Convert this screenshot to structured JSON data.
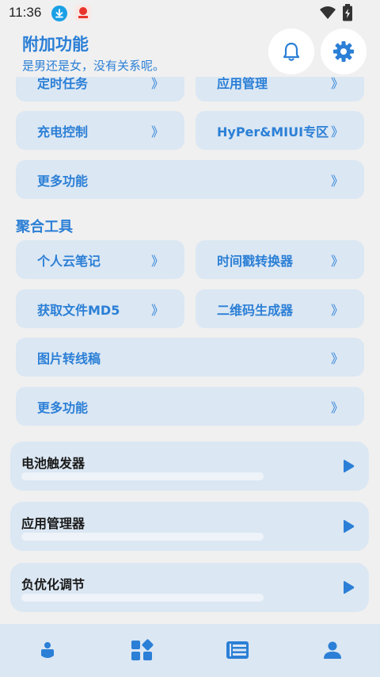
{
  "status": {
    "time": "11:36"
  },
  "header": {
    "title": "附加功能",
    "subtitle": "是男还是女，没有关系呢。"
  },
  "chevron": "》",
  "top_rows": [
    {
      "left": "定时任务",
      "right": "应用管理"
    },
    {
      "left": "充电控制",
      "right": "HyPer&MIUI专区"
    }
  ],
  "top_more": "更多功能",
  "section2": {
    "title": "聚合工具",
    "rows": [
      {
        "left": "个人云笔记",
        "right": "时间戳转换器"
      },
      {
        "left": "获取文件MD5",
        "right": "二维码生成器"
      }
    ],
    "single": "图片转线稿",
    "more": "更多功能"
  },
  "tools": [
    {
      "name": "电池触发器"
    },
    {
      "name": "应用管理器"
    },
    {
      "name": "负优化调节"
    }
  ],
  "colors": {
    "accent": "#2b7fd6",
    "card": "#dbe7f3",
    "background": "#f0f0f0"
  },
  "icons": {
    "bell": "bell-icon",
    "gear": "gear-icon",
    "play": "play-icon",
    "nav": [
      "person-badge-icon",
      "apps-grid-icon",
      "list-panel-icon",
      "user-icon"
    ]
  }
}
